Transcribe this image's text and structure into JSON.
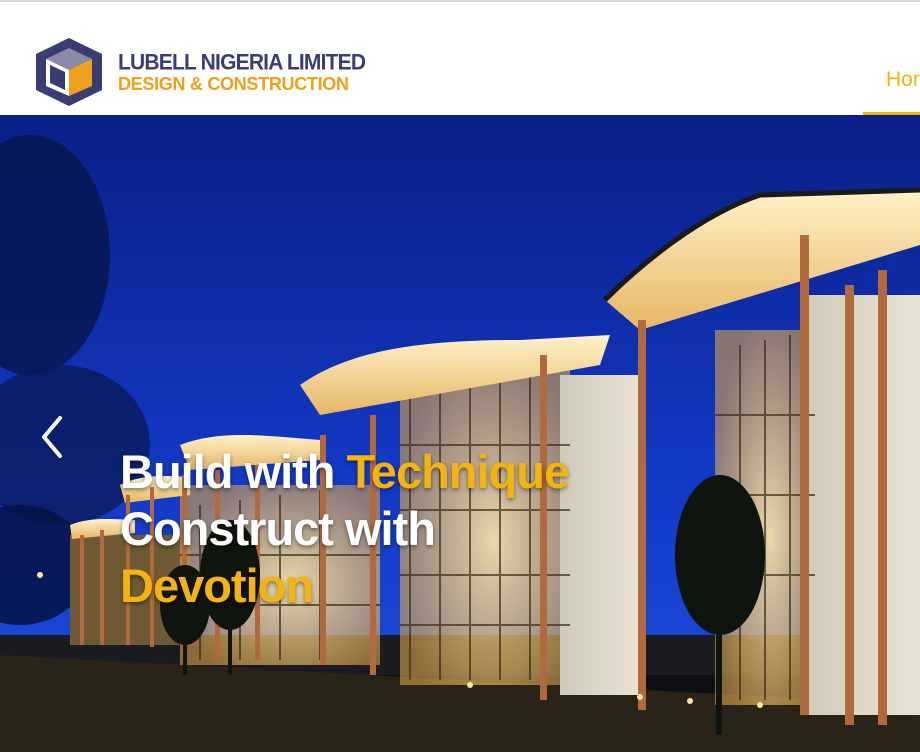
{
  "header": {
    "brand_name": "LUBELL NIGERIA LIMITED",
    "brand_tagline": "DESIGN & CONSTRUCTION",
    "logo_icon": "cube-logo-icon"
  },
  "nav": {
    "items": [
      {
        "label": "Hor",
        "active": true
      }
    ]
  },
  "hero": {
    "line1_white": "Build with ",
    "line1_accent": "Technique",
    "line2_white": "Construct with",
    "line3_accent": "Devotion",
    "prev_icon": "chevron-left-icon"
  },
  "colors": {
    "brand_navy": "#3a3c74",
    "accent_gold": "#f5b30e",
    "sky_blue": "#0b2a9a"
  }
}
